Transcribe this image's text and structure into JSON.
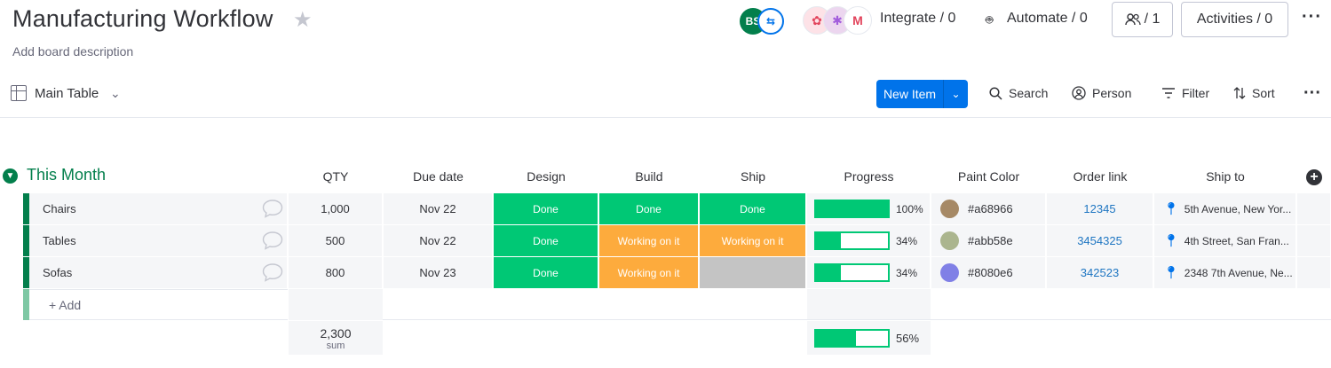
{
  "board": {
    "title": "Manufacturing Workflow",
    "description": "Add board description",
    "star_icon": "star-icon"
  },
  "header": {
    "avatar_initials": "BS",
    "integrate_label": "Integrate / 0",
    "automate_label": "Automate / 0",
    "members_label": "/ 1",
    "activities_label": "Activities / 0"
  },
  "toolbar": {
    "view_label": "Main Table",
    "new_item_label": "New Item",
    "search_label": "Search",
    "person_label": "Person",
    "filter_label": "Filter",
    "sort_label": "Sort"
  },
  "group": {
    "title": "This Month",
    "color": "#037f4c",
    "columns": {
      "qty": "QTY",
      "due": "Due date",
      "design": "Design",
      "build": "Build",
      "ship": "Ship",
      "progress": "Progress",
      "paint": "Paint Color",
      "order": "Order link",
      "shipto": "Ship to"
    },
    "rows": [
      {
        "name": "Chairs",
        "qty": "1,000",
        "due": "Nov 22",
        "design": {
          "label": "Done",
          "color": "#00c875"
        },
        "build": {
          "label": "Done",
          "color": "#00c875"
        },
        "ship": {
          "label": "Done",
          "color": "#00c875"
        },
        "progress": {
          "value": 100,
          "label": "100%"
        },
        "paint": {
          "hex": "#a68966",
          "label": "#a68966"
        },
        "order": "12345",
        "shipto": "5th Avenue, New Yor..."
      },
      {
        "name": "Tables",
        "qty": "500",
        "due": "Nov 22",
        "design": {
          "label": "Done",
          "color": "#00c875"
        },
        "build": {
          "label": "Working on it",
          "color": "#fdab3d"
        },
        "ship": {
          "label": "Working on it",
          "color": "#fdab3d"
        },
        "progress": {
          "value": 34,
          "label": "34%"
        },
        "paint": {
          "hex": "#abb58e",
          "label": "#abb58e"
        },
        "order": "3454325",
        "shipto": "4th Street, San Fran..."
      },
      {
        "name": "Sofas",
        "qty": "800",
        "due": "Nov 23",
        "design": {
          "label": "Done",
          "color": "#00c875"
        },
        "build": {
          "label": "Working on it",
          "color": "#fdab3d"
        },
        "ship": {
          "label": "",
          "color": "#c4c4c4"
        },
        "progress": {
          "value": 34,
          "label": "34%"
        },
        "paint": {
          "hex": "#8080e6",
          "label": "#8080e6"
        },
        "order": "342523",
        "shipto": "2348 7th Avenue, Ne..."
      }
    ],
    "add_label": "+ Add",
    "summary": {
      "qty_sum": "2,300",
      "qty_sum_label": "sum",
      "progress": {
        "value": 56,
        "label": "56%"
      }
    }
  }
}
